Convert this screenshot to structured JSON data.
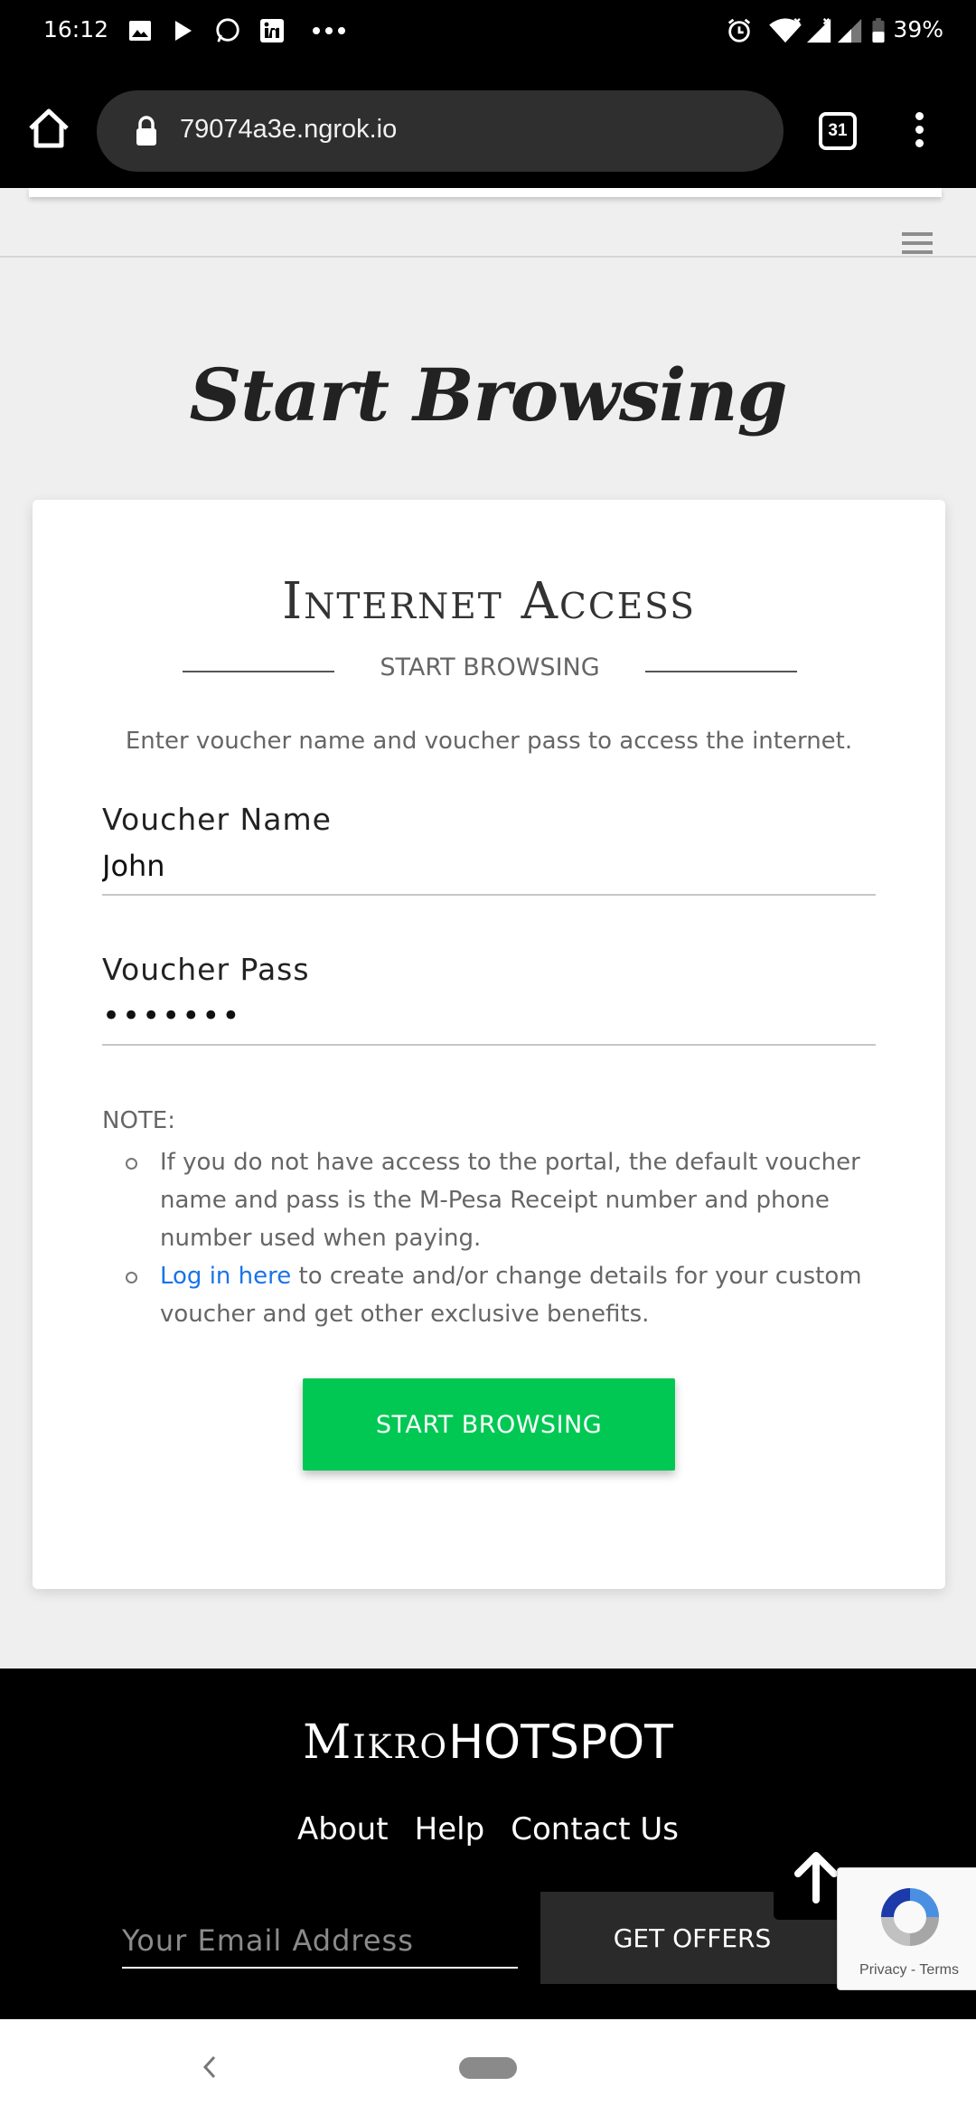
{
  "status_bar": {
    "time": "16:12",
    "battery": "39%",
    "notification_icons": [
      "image-icon",
      "play-icon",
      "whatsapp-icon",
      "linkedin-icon",
      "more-dots-icon"
    ],
    "system_icons": [
      "alarm-icon",
      "wifi-icon",
      "signal-icon",
      "signal-icon-2",
      "battery-icon"
    ]
  },
  "browser": {
    "url": "79074a3e.ngrok.io",
    "tab_count": "31"
  },
  "page": {
    "heading": "Start Browsing"
  },
  "card": {
    "title": "Internet Access",
    "subtitle": "START BROWSING",
    "intro": "Enter voucher name and voucher pass to access the internet.",
    "voucher_name_label": "Voucher Name",
    "voucher_name_value": "John",
    "voucher_pass_label": "Voucher Pass",
    "voucher_pass_value": "•••••••",
    "note_label": "NOTE:",
    "note_1": "If you do not have access to the portal, the default voucher name and pass is the M-Pesa Receipt number and phone number used when paying.",
    "note_2_link": "Log in here",
    "note_2_rest": " to create and/or change details for your custom voucher and get other exclusive benefits.",
    "button": "START BROWSING"
  },
  "footer": {
    "brand_part1": "Mikro",
    "brand_part2": "HOTSPOT",
    "links": [
      "About",
      "Help",
      "Contact Us"
    ],
    "email_placeholder": "Your Email Address",
    "offers_button": "GET OFFERS",
    "recaptcha_text": "Privacy - Terms"
  },
  "colors": {
    "primary_button": "#00c853",
    "link": "#1a73e8",
    "footer_bg": "#000000"
  }
}
